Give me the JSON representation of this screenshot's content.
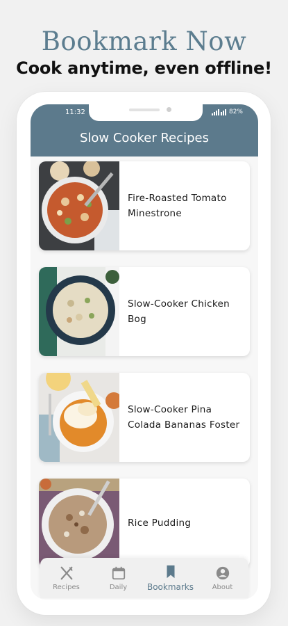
{
  "promo": {
    "title": "Bookmark Now",
    "subtitle": "Cook anytime, even offline!"
  },
  "status_bar": {
    "time": "11:32",
    "battery": "82%"
  },
  "header": {
    "title": "Slow Cooker Recipes"
  },
  "recipes": [
    {
      "title": "Fire-Roasted Tomato Minestrone",
      "image_icon": "soup-bowl-photo"
    },
    {
      "title": "Slow-Cooker Chicken Bog",
      "image_icon": "rice-plate-photo"
    },
    {
      "title": "Slow-Cooker Pina Colada Bananas Foster",
      "image_icon": "dessert-bowl-photo"
    },
    {
      "title": "Rice Pudding",
      "image_icon": "pudding-bowl-photo"
    }
  ],
  "tabs": [
    {
      "label": "Recipes",
      "icon": "fork-knife-icon",
      "active": false
    },
    {
      "label": "Daily",
      "icon": "calendar-icon",
      "active": false
    },
    {
      "label": "Bookmarks",
      "icon": "bookmark-icon",
      "active": true
    },
    {
      "label": "About",
      "icon": "user-icon",
      "active": false
    }
  ],
  "colors": {
    "accent": "#5c7a8c",
    "promo_title": "#5c7d8f",
    "background": "#f1f1f1"
  }
}
